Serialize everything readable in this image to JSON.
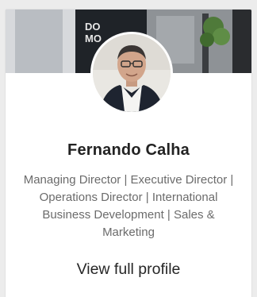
{
  "profile": {
    "name": "Fernando Calha",
    "headline": "Managing Director | Executive Director | Operations Director | International Business Development | Sales & Marketing",
    "view_profile_label": "View full profile"
  },
  "cover": {
    "sign_text_line1": "DO",
    "sign_text_line2": "MO"
  },
  "colors": {
    "card_background": "#ffffff",
    "page_background": "#ececec",
    "name_text": "#222222",
    "headline_text": "#6b6b6b"
  }
}
